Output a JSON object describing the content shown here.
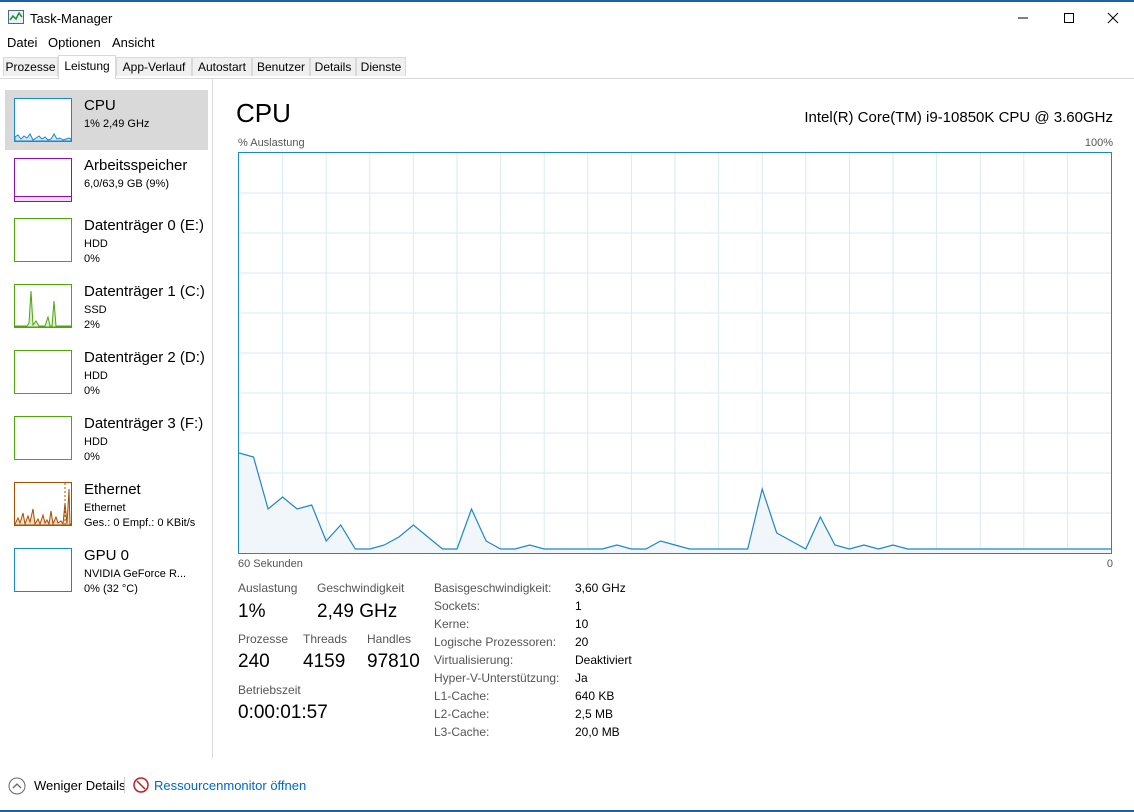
{
  "window": {
    "title": "Task-Manager"
  },
  "menu": [
    "Datei",
    "Optionen",
    "Ansicht"
  ],
  "tabs": [
    "Prozesse",
    "Leistung",
    "App-Verlauf",
    "Autostart",
    "Benutzer",
    "Details",
    "Dienste"
  ],
  "active_tab": "Leistung",
  "sidebar": [
    {
      "name": "CPU",
      "line1": "1% 2,49 GHz",
      "color": "#1c87c9",
      "selected": true
    },
    {
      "name": "Arbeitsspeicher",
      "line1": "6,0/63,9 GB (9%)",
      "color": "#8b12ae",
      "level": 0.09
    },
    {
      "name": "Datenträger 0 (E:)",
      "line1": "HDD",
      "line2": "0%",
      "color": "#4da60c"
    },
    {
      "name": "Datenträger 1 (C:)",
      "line1": "SSD",
      "line2": "2%",
      "color": "#4da60c"
    },
    {
      "name": "Datenträger 2 (D:)",
      "line1": "HDD",
      "line2": "0%",
      "color": "#4da60c"
    },
    {
      "name": "Datenträger 3 (F:)",
      "line1": "HDD",
      "line2": "0%",
      "color": "#4da60c"
    },
    {
      "name": "Ethernet",
      "line1": "Ethernet",
      "line2": "Ges.: 0 Empf.: 0 KBit/s",
      "color": "#a74f01"
    },
    {
      "name": "GPU 0",
      "line1": "NVIDIA GeForce R...",
      "line2": "0% (32 °C)",
      "color": "#1c87c9"
    }
  ],
  "cpu": {
    "title": "CPU",
    "model": "Intel(R) Core(TM) i9-10850K CPU @ 3.60GHz",
    "ylabel": "% Auslastung",
    "ymax_label": "100%",
    "xlabel": "60 Sekunden",
    "xmin_label": "0",
    "stats": {
      "auslastung_label": "Auslastung",
      "auslastung": "1%",
      "geschwindigkeit_label": "Geschwindigkeit",
      "geschwindigkeit": "2,49 GHz",
      "prozesse_label": "Prozesse",
      "prozesse": "240",
      "threads_label": "Threads",
      "threads": "4159",
      "handles_label": "Handles",
      "handles": "97810",
      "betriebszeit_label": "Betriebszeit",
      "betriebszeit": "0:00:01:57"
    },
    "details": [
      {
        "key": "Basisgeschwindigkeit:",
        "value": "3,60 GHz"
      },
      {
        "key": "Sockets:",
        "value": "1"
      },
      {
        "key": "Kerne:",
        "value": "10"
      },
      {
        "key": "Logische Prozessoren:",
        "value": "20"
      },
      {
        "key": "Virtualisierung:",
        "value": "Deaktiviert"
      },
      {
        "key": "Hyper-V-Unterstützung:",
        "value": "Ja"
      },
      {
        "key": "L1-Cache:",
        "value": "640 KB"
      },
      {
        "key": "L2-Cache:",
        "value": "2,5 MB"
      },
      {
        "key": "L3-Cache:",
        "value": "20,0 MB"
      }
    ]
  },
  "chart_data": {
    "type": "area",
    "x": [
      60,
      59,
      58,
      57,
      56,
      55,
      54,
      53,
      52,
      51,
      50,
      49,
      48,
      47,
      46,
      45,
      44,
      43,
      42,
      41,
      40,
      39,
      38,
      37,
      36,
      35,
      34,
      33,
      32,
      31,
      30,
      29,
      28,
      27,
      26,
      25,
      24,
      23,
      22,
      21,
      20,
      19,
      18,
      17,
      16,
      15,
      14,
      13,
      12,
      11,
      10,
      9,
      8,
      7,
      6,
      5,
      4,
      3,
      2,
      1,
      0
    ],
    "values": [
      25,
      24,
      11,
      14,
      11,
      12,
      3,
      7,
      1,
      1,
      2,
      4,
      7,
      4,
      1,
      1,
      11,
      3,
      1,
      1,
      2,
      1,
      1,
      1,
      1,
      1,
      2,
      1,
      1,
      3,
      2,
      1,
      1,
      1,
      1,
      1,
      16,
      5,
      3,
      1,
      9,
      2,
      1,
      2,
      1,
      2,
      1,
      1,
      1,
      1,
      1,
      1,
      1,
      1,
      1,
      1,
      1,
      1,
      1,
      1,
      1
    ],
    "ylim": [
      0,
      100
    ],
    "xlim": [
      60,
      0
    ],
    "grid": true,
    "color": "#1c87c9"
  },
  "footer": {
    "less_details": "Weniger Details",
    "resource_monitor": "Ressourcenmonitor öffnen"
  }
}
